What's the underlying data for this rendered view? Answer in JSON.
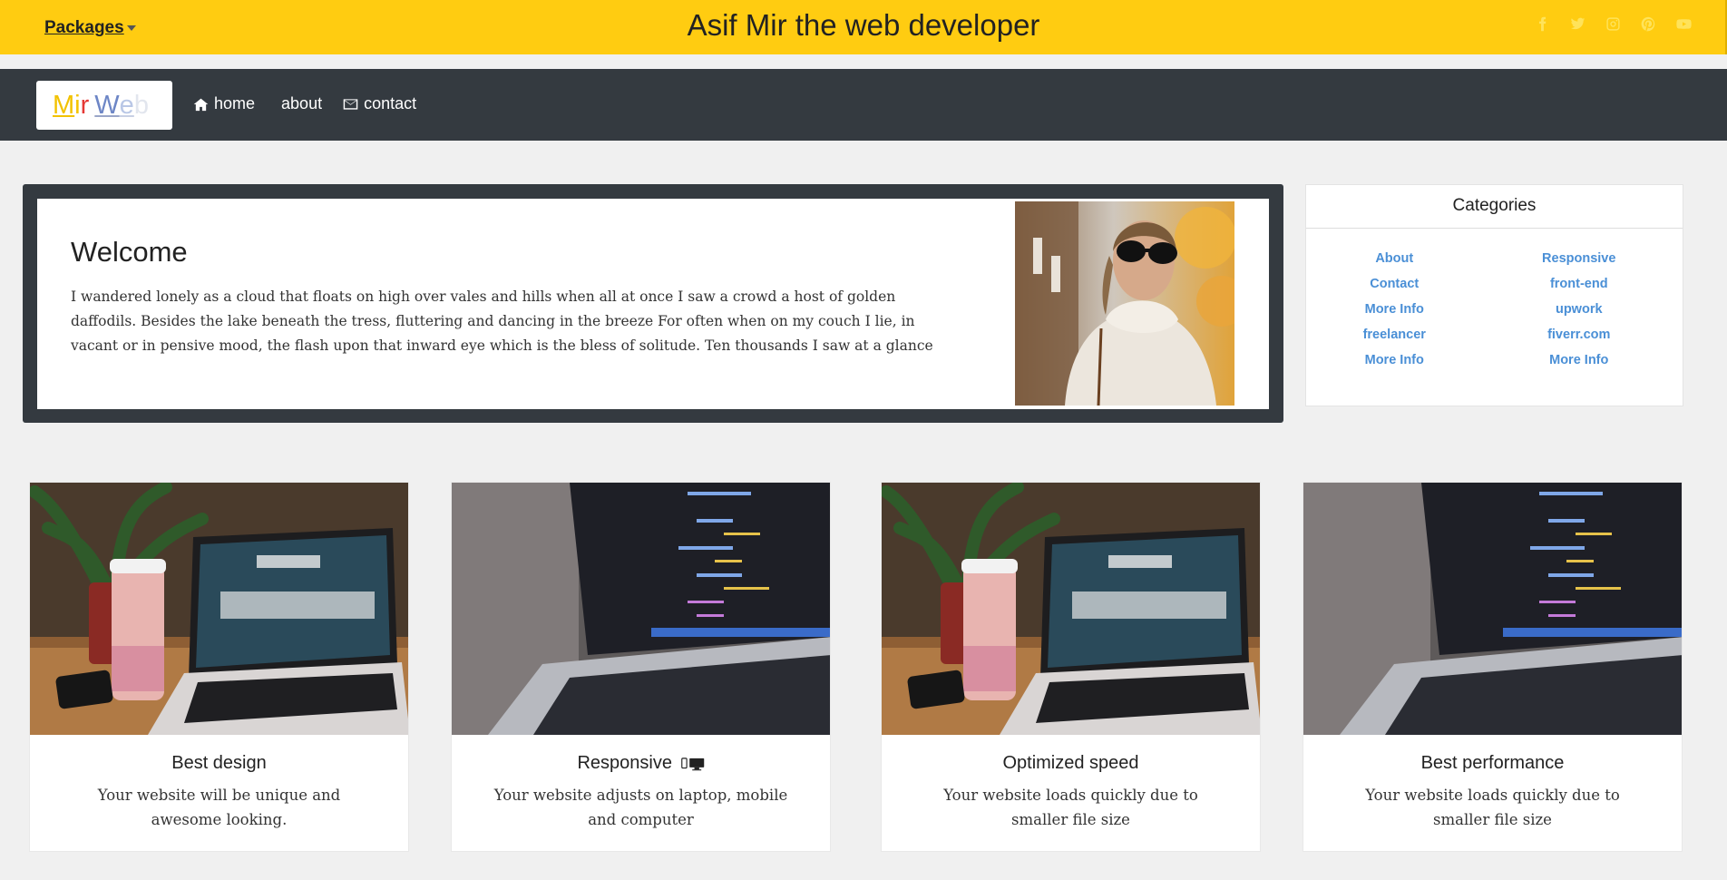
{
  "topbar": {
    "packages_label": "Packages",
    "title": "Asif Mir the web developer",
    "socials": [
      "facebook-icon",
      "twitter-icon",
      "instagram-icon",
      "pinterest-icon",
      "youtube-icon"
    ]
  },
  "nav": {
    "brand": [
      "M",
      "i",
      "r",
      " ",
      "W",
      "e",
      "b"
    ],
    "brand_colors": [
      "#f2c200",
      "#f5c400",
      "#e53935",
      "#ffffff",
      "#6d86c6",
      "#b9c7e6",
      "#e2e6ee"
    ],
    "links": [
      {
        "label": "home",
        "icon": "home-icon"
      },
      {
        "label": "about",
        "icon": ""
      },
      {
        "label": "contact",
        "icon": "envelope-icon"
      }
    ]
  },
  "welcome": {
    "title": "Welcome",
    "text": "I wandered lonely as a cloud that floats on high over vales and hills when all at once I saw a crowd a host of golden daffodils. Besides the lake beneath the tress, fluttering and dancing in the breeze For often when on my couch I lie, in vacant or in pensive mood, the flash upon that inward eye which is the bless of solitude. Ten thousands I saw at a glance"
  },
  "categories": {
    "title": "Categories",
    "links": [
      "About",
      "Responsive",
      "Contact",
      "front-end",
      "More Info",
      "upwork",
      "freelancer",
      "fiverr.com",
      "More Info",
      "More Info"
    ]
  },
  "cards": [
    {
      "title": "Best design",
      "text": "Your website will be unique and awesome looking."
    },
    {
      "title": "Responsive",
      "text": "Your website adjusts on laptop, mobile and computer",
      "icons": [
        "mobile-icon",
        "desktop-icon"
      ]
    },
    {
      "title": "Optimized speed",
      "text": "Your website loads quickly due to smaller file size"
    },
    {
      "title": "Best performance",
      "text": "Your website loads quickly due to smaller file size"
    }
  ],
  "colors": {
    "topbar": "#ffcc11",
    "navbar": "#343a40",
    "link": "#4a8fd6",
    "background": "#f0f0f0"
  }
}
